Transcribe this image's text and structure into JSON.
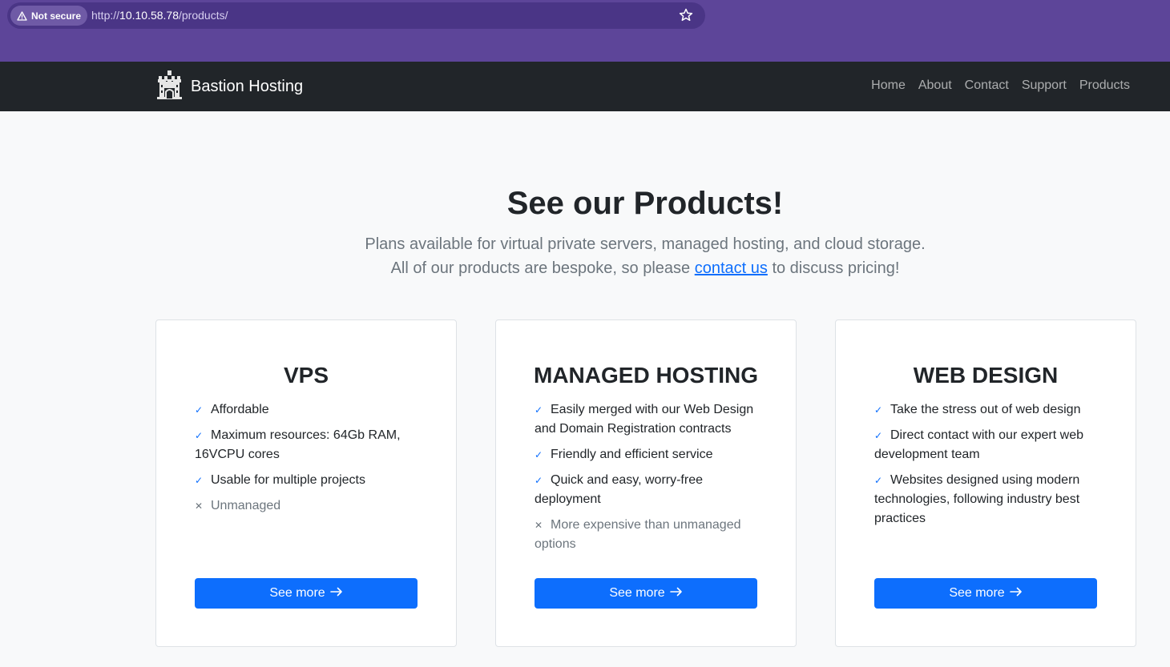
{
  "browser": {
    "security_label": "Not secure",
    "url_prefix": "http://",
    "url_host": "10.10.58.78",
    "url_path": "/products/"
  },
  "navbar": {
    "brand": "Bastion Hosting",
    "links": [
      "Home",
      "About",
      "Contact",
      "Support",
      "Products"
    ]
  },
  "hero": {
    "title": "See our Products!",
    "lead_line1": "Plans available for virtual private servers, managed hosting, and cloud storage.",
    "lead_line2_before": "All of our products are bespoke, so please ",
    "lead_link": "contact us",
    "lead_line2_after": " to discuss pricing!"
  },
  "cards": [
    {
      "title": "VPS",
      "features": [
        {
          "text": "Affordable",
          "included": true
        },
        {
          "text": "Maximum resources: 64Gb RAM, 16VCPU cores",
          "included": true
        },
        {
          "text": "Usable for multiple projects",
          "included": true
        },
        {
          "text": "Unmanaged",
          "included": false
        }
      ],
      "button": "See more"
    },
    {
      "title": "MANAGED HOSTING",
      "features": [
        {
          "text": "Easily merged with our Web Design and Domain Registration contracts",
          "included": true
        },
        {
          "text": "Friendly and efficient service",
          "included": true
        },
        {
          "text": "Quick and easy, worry-free deployment",
          "included": true
        },
        {
          "text": "More expensive than unmanaged options",
          "included": false
        }
      ],
      "button": "See more"
    },
    {
      "title": "WEB DESIGN",
      "features": [
        {
          "text": "Take the stress out of web design",
          "included": true
        },
        {
          "text": "Direct contact with our expert web development team",
          "included": true
        },
        {
          "text": "Websites designed using modern technologies, following industry best practices",
          "included": true
        }
      ],
      "button": "See more"
    }
  ],
  "icons": {
    "check": "check-icon",
    "cross": "cross-icon",
    "arrow": "arrow-right-icon",
    "warning": "warning-icon",
    "star": "star-icon",
    "logo": "castle-logo-icon"
  },
  "colors": {
    "browser_bar": "#5d4599",
    "navbar": "#212529",
    "primary": "#0d6efd",
    "muted": "#6c757d"
  }
}
